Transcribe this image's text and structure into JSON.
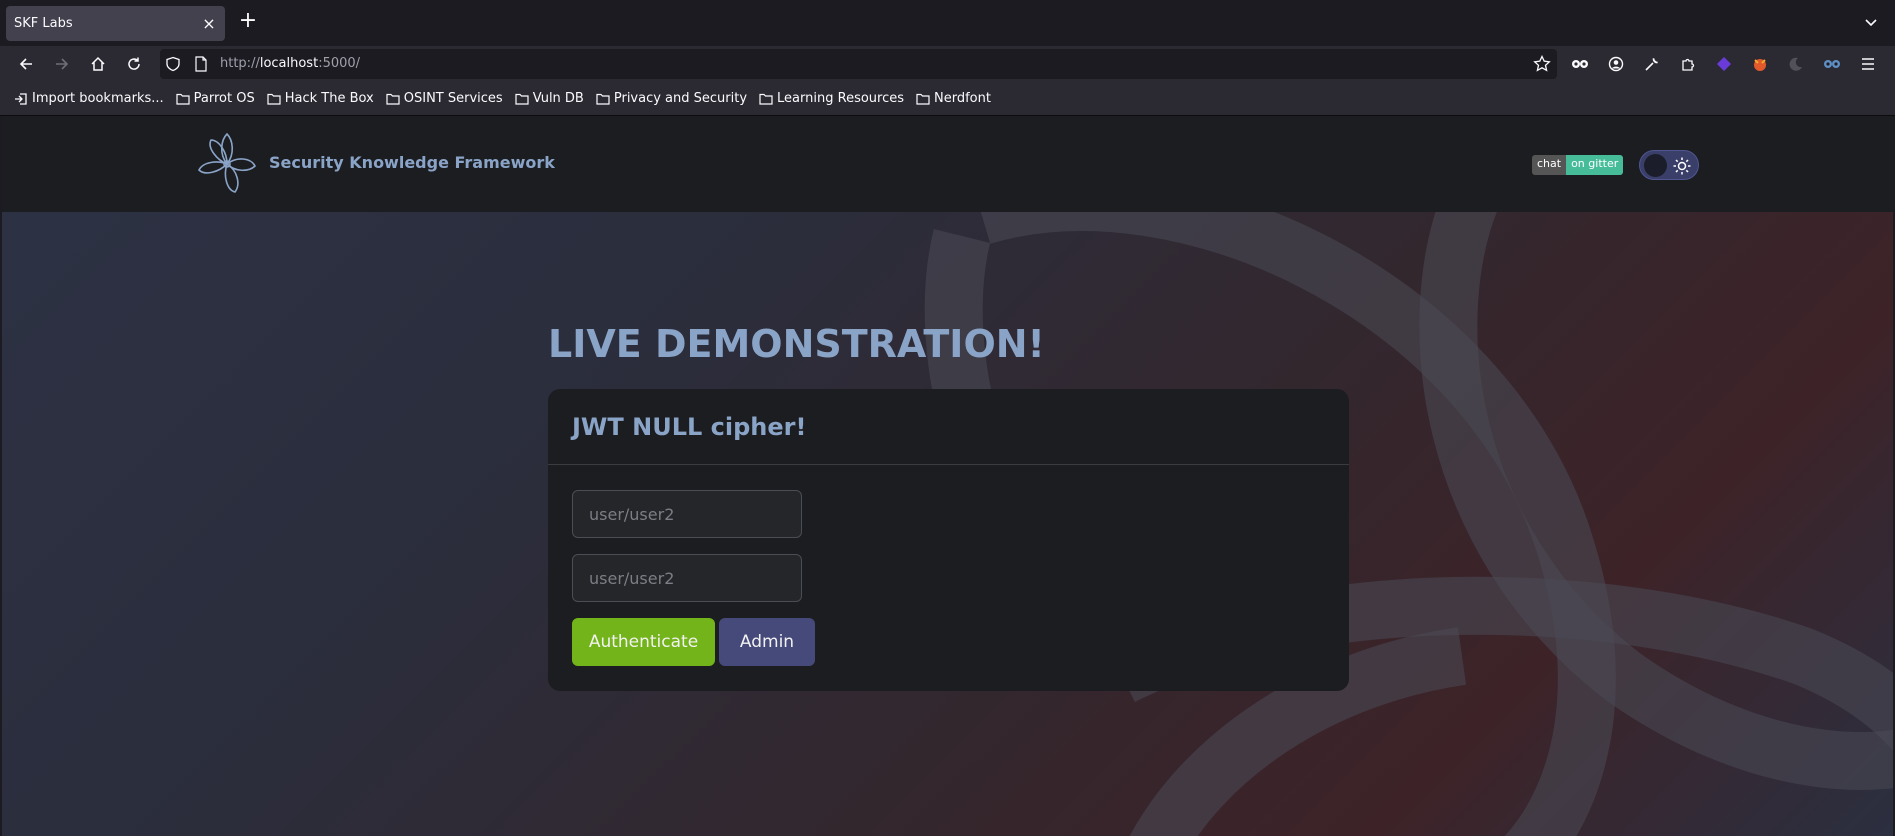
{
  "browser": {
    "tab_title": "SKF Labs",
    "url_host_prefix": "http://",
    "url_host": "localhost",
    "url_rest": ":5000/",
    "bookmarks": [
      "Import bookmarks...",
      "Parrot OS",
      "Hack The Box",
      "OSINT Services",
      "Vuln DB",
      "Privacy and Security",
      "Learning Resources",
      "Nerdfont"
    ]
  },
  "site": {
    "brand": "Security Knowledge Framework",
    "badge_left": "chat",
    "badge_right": "on gitter"
  },
  "main": {
    "hero_title": "LIVE DEMONSTRATION!",
    "card_title": "JWT NULL cipher!",
    "username_placeholder": "user/user2",
    "password_placeholder": "user/user2",
    "authenticate_label": "Authenticate",
    "admin_label": "Admin"
  },
  "colors": {
    "accent_blue": "#8aa4c8",
    "authenticate_green": "#73b41a",
    "admin_purple": "#464a7a",
    "gitter_green": "#46bc99"
  }
}
